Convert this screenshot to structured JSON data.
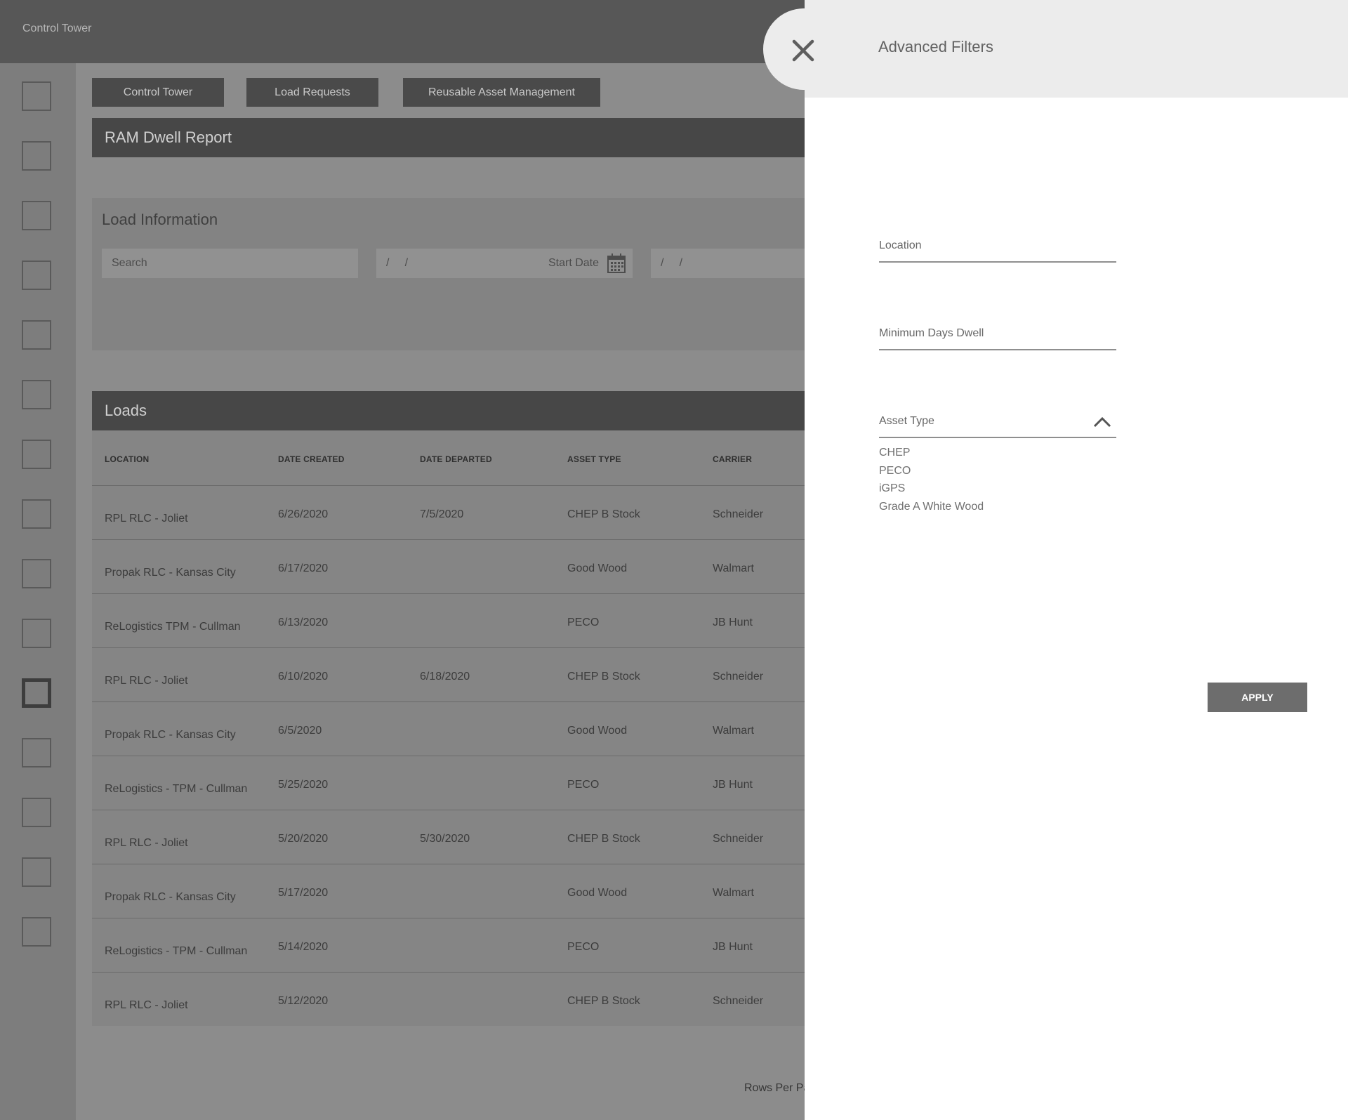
{
  "app_title": "Control Tower",
  "nav": [
    "Control Tower",
    "Load Requests",
    "Reusable Asset Management"
  ],
  "report_title": "RAM Dwell Report",
  "load_info": {
    "title": "Load Information",
    "search_placeholder": "Search",
    "start_date_value": "/     /",
    "start_date_label": "Start Date",
    "end_date_value": "/     /"
  },
  "loads": {
    "title": "Loads",
    "columns": [
      "LOCATION",
      "DATE CREATED",
      "DATE DEPARTED",
      "ASSET TYPE",
      "CARRIER"
    ],
    "rows": [
      [
        "RPL RLC - Joliet",
        "6/26/2020",
        "7/5/2020",
        "CHEP B Stock",
        "Schneider"
      ],
      [
        "Propak RLC - Kansas City",
        "6/17/2020",
        "",
        "Good Wood",
        "Walmart"
      ],
      [
        "ReLogistics TPM - Cullman",
        "6/13/2020",
        "",
        "PECO",
        "JB Hunt"
      ],
      [
        "RPL RLC - Joliet",
        "6/10/2020",
        "6/18/2020",
        "CHEP B Stock",
        "Schneider"
      ],
      [
        "Propak RLC - Kansas City",
        "6/5/2020",
        "",
        "Good Wood",
        "Walmart"
      ],
      [
        "ReLogistics - TPM - Cullman",
        "5/25/2020",
        "",
        "PECO",
        "JB Hunt"
      ],
      [
        "RPL RLC - Joliet",
        "5/20/2020",
        "5/30/2020",
        "CHEP B Stock",
        "Schneider"
      ],
      [
        "Propak RLC - Kansas City",
        "5/17/2020",
        "",
        "Good Wood",
        "Walmart"
      ],
      [
        "ReLogistics - TPM - Cullman",
        "5/14/2020",
        "",
        "PECO",
        "JB Hunt"
      ],
      [
        "RPL RLC - Joliet",
        "5/12/2020",
        "",
        "CHEP B Stock",
        "Schneider"
      ]
    ],
    "rows_per_page_label": "Rows Per Pa"
  },
  "filters": {
    "title": "Advanced Filters",
    "location_label": "Location",
    "min_days_label": "Minimum Days Dwell",
    "asset_type_label": "Asset Type",
    "asset_type_options": [
      "CHEP",
      "PECO",
      "iGPS",
      "Grade A White Wood"
    ],
    "apply_label": "APPLY"
  },
  "icons": {
    "close": "close-icon",
    "calendar": "calendar-icon",
    "chevron": "chevron-up-icon"
  },
  "colors": {
    "topbar": "#575757",
    "banner": "#474747",
    "drawer_header": "#ececec",
    "apply_button": "#6d6d6d"
  }
}
